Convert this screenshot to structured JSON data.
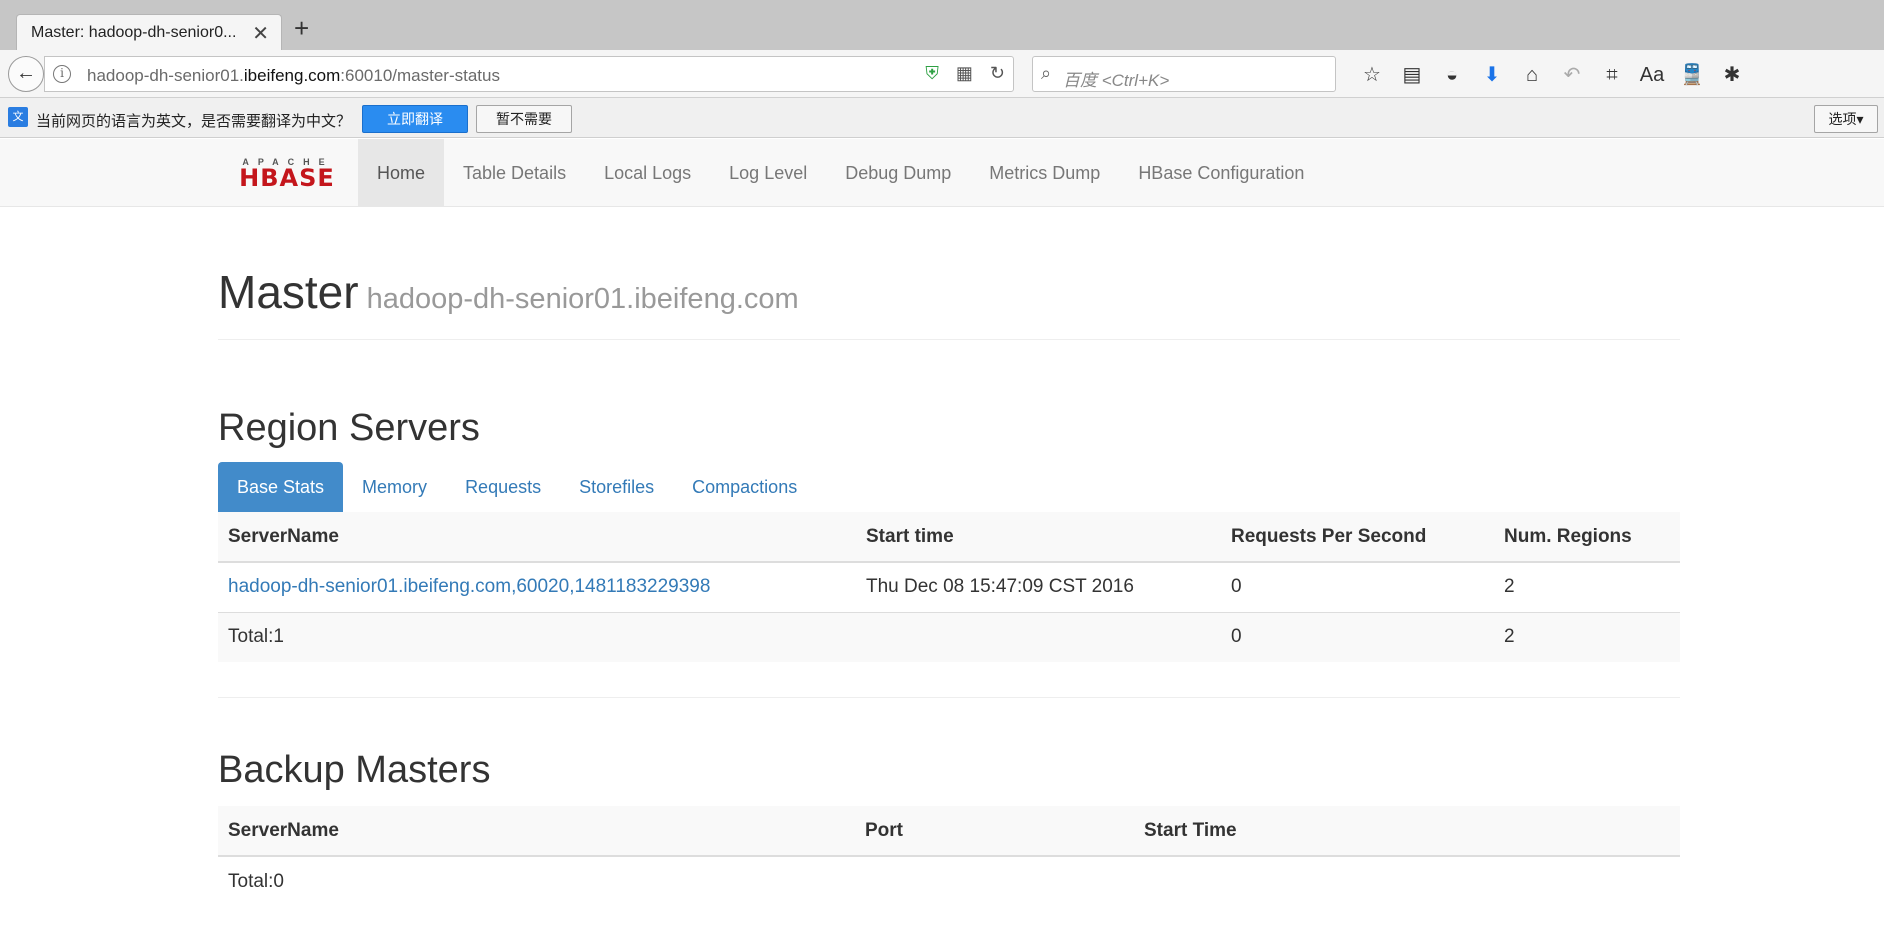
{
  "browser": {
    "tab_title": "Master: hadoop-dh-senior0...",
    "url_host": "hadoop-dh-senior01.ibeifeng.com",
    "url_prefix": "hadoop-dh-senior01.",
    "url_domain": "ibeifeng.com",
    "url_rest": ":60010/master-status",
    "search_placeholder": "百度 <Ctrl+K>"
  },
  "translate_bar": {
    "message": "当前网页的语言为英文，是否需要翻译为中文？",
    "translate_button": "立即翻译",
    "decline_button": "暂不需要",
    "options_button": "选项▾"
  },
  "logo": {
    "top_text": "APACHE",
    "main_text": "HBASE"
  },
  "nav": {
    "items": [
      "Home",
      "Table Details",
      "Local Logs",
      "Log Level",
      "Debug Dump",
      "Metrics Dump",
      "HBase Configuration"
    ]
  },
  "header": {
    "title": "Master",
    "host": "hadoop-dh-senior01.ibeifeng.com"
  },
  "region_servers": {
    "title": "Region Servers",
    "tabs": [
      "Base Stats",
      "Memory",
      "Requests",
      "Storefiles",
      "Compactions"
    ],
    "columns": [
      "ServerName",
      "Start time",
      "Requests Per Second",
      "Num. Regions"
    ],
    "rows": [
      {
        "server": "hadoop-dh-senior01.ibeifeng.com,60020,1481183229398",
        "start_time": "Thu Dec 08 15:47:09 CST 2016",
        "rps": "0",
        "regions": "2"
      }
    ],
    "total": {
      "label": "Total:1",
      "rps": "0",
      "regions": "2"
    }
  },
  "backup_masters": {
    "title": "Backup Masters",
    "columns": [
      "ServerName",
      "Port",
      "Start Time"
    ],
    "total": "Total:0"
  },
  "colors": {
    "link": "#337ab7",
    "active_tab": "#428bca",
    "hbase_red": "#c4161c"
  }
}
